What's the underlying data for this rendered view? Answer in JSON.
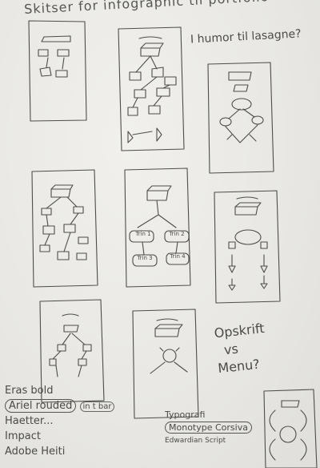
{
  "notes": {
    "title": "Skitser for infographic til portfolio",
    "lasagne": "I humor til lasagne?",
    "opskrift_line1": "Opskrift",
    "opskrift_line2": "vs",
    "opskrift_line3": "Menu?"
  },
  "fonts": {
    "eras": "Eras bold",
    "ariel": "Ariel rouded",
    "ariel_note": "in t bar",
    "haettenschweiler": "Haetter...",
    "impact": "Impact",
    "adobe": "Adobe Heiti"
  },
  "typography": {
    "heading": "Typografi",
    "monotype": "Monotype Corsiva",
    "edwardian": "Edwardian Script"
  },
  "sketch_labels": {
    "trin1": "Trin 1",
    "trin2": "Trin 2",
    "trin3": "Trin 3",
    "trin4": "Trin 4"
  }
}
